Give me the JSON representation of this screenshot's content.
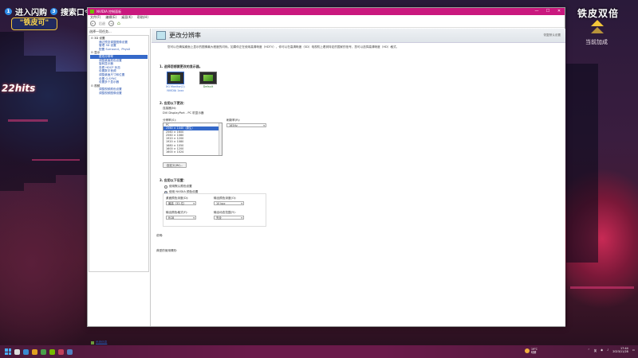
{
  "overlay": {
    "step1_num": "1",
    "step1_text": "进入闪购",
    "step2_num": "3",
    "step2_text": "搜索口令",
    "badge": "\"铁皮可\"",
    "combo_text": "22hits",
    "brand_main": "铁皮双倍",
    "brand_sub": "当前加成"
  },
  "window": {
    "title": "NVIDIA 控制面板",
    "min": "—",
    "max": "☐",
    "close": "✕"
  },
  "menu": [
    "文件(F)",
    "编辑(E)",
    "桌面(K)",
    "帮助(H)"
  ],
  "toolbar": {
    "back": "←",
    "back_label": "后退",
    "forward": "→",
    "home": "⌂"
  },
  "sidebar": {
    "header": "选择一项任务...",
    "tree": [
      {
        "type": "cat",
        "label": "3D 设置"
      },
      {
        "type": "item",
        "label": "通过预览调整图像设置"
      },
      {
        "type": "item",
        "label": "管理 3D 设置"
      },
      {
        "type": "item",
        "label": "配置 Surround、PhysX"
      },
      {
        "type": "cat",
        "label": "显示"
      },
      {
        "type": "item",
        "label": "更改分辨率",
        "selected": true
      },
      {
        "type": "item",
        "label": "调整桌面颜色设置"
      },
      {
        "type": "item",
        "label": "旋转显示器"
      },
      {
        "type": "item",
        "label": "查看 HDCP 状态"
      },
      {
        "type": "item",
        "label": "设置数字音频"
      },
      {
        "type": "item",
        "label": "调整桌面尺寸和位置"
      },
      {
        "type": "item",
        "label": "设置 G-SYNC"
      },
      {
        "type": "item",
        "label": "设置多个显示器"
      },
      {
        "type": "cat",
        "label": "视频"
      },
      {
        "type": "item",
        "label": "调整视频颜色设置"
      },
      {
        "type": "item",
        "label": "调整视频图像设置"
      }
    ],
    "system_info": "系统信息"
  },
  "page": {
    "title": "更改分辨率",
    "restore": "恢复默认设置",
    "description": "您可以在确保桌面上显示的图像最大程度的闪烁。如果你正在使用高清晰度（HDTV），你可以在高清晰度（SD）电视机上看到特定的国家的信号，您可以选择高清晰度（HD）格式。",
    "section1": "1. 选择您想要更改的显示器。",
    "monitors": [
      {
        "name": "XG Monitor(2)",
        "sub": "NVIDIA 1xxx",
        "selected": true
      },
      {
        "name": "Default",
        "sub": "",
        "selected": false
      }
    ],
    "section2": "2. 应用以下更改：",
    "connection_label": "连接器(N):",
    "connection_value": "DVI   DisplayPort - PC 机显示器",
    "resolution_label": "分辨率(S):",
    "refresh_label": "刷新率(R):",
    "refresh_value": "165Hz",
    "resolutions": [
      "PC",
      "2560 × 1440（原生）",
      "2560 × 1600",
      "2560 × 1080",
      "1920 × 1200",
      "1920 × 1080",
      "1680 × 1050",
      "1600 × 1200",
      "1600 × 1024"
    ],
    "custom_button": "自定义(W)...",
    "section3": "3. 应用以下设置：",
    "radio_default": "使用默认颜色设置",
    "radio_nvidia": "使用 NVIDIA 颜色设置",
    "desktop_depth_label": "桌面颜色深度(D):",
    "desktop_depth_value": "最高（32-位）",
    "output_depth_label": "输出颜色深度(O):",
    "output_depth_value": "10 bpc",
    "output_format_label": "输出颜色格式(F):",
    "output_format_value": "RGB",
    "output_range_label": "输出动态范围(Y):",
    "output_range_value": "完全",
    "desc_label": "说明:",
    "usage_label": "典型的使用情形:"
  },
  "taskbar": {
    "weather_temp": "19°C",
    "weather_desc": "晴朗",
    "time": "17:44",
    "date": "2023/11/28",
    "lang": "英"
  }
}
